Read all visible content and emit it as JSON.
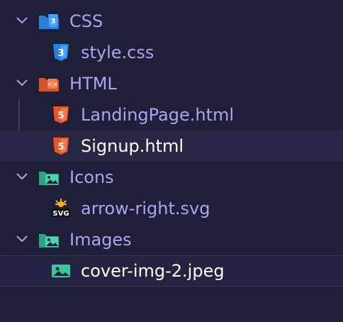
{
  "explorer": {
    "folders": [
      {
        "name": "CSS",
        "icon": "css-folder-icon",
        "files": [
          {
            "name": "style.css",
            "icon": "css3-file-icon"
          }
        ]
      },
      {
        "name": "HTML",
        "icon": "html-folder-icon",
        "files": [
          {
            "name": "LandingPage.html",
            "icon": "html5-file-icon"
          },
          {
            "name": "Signup.html",
            "icon": "html5-file-icon",
            "selected": true
          }
        ]
      },
      {
        "name": "Icons",
        "icon": "image-folder-icon",
        "files": [
          {
            "name": "arrow-right.svg",
            "icon": "svg-file-icon"
          }
        ]
      },
      {
        "name": "Images",
        "icon": "image-folder-icon",
        "files": [
          {
            "name": "cover-img-2.jpeg",
            "icon": "image-file-icon",
            "highlighted": true
          }
        ]
      }
    ]
  },
  "colors": {
    "background": "#1e1f38",
    "label": "#a8a6f0",
    "label_active": "#ffffff",
    "css_blue": "#2a7fd8",
    "html_orange": "#e8562a",
    "image_green": "#36c8a0",
    "svg_yellow": "#ffb300"
  }
}
